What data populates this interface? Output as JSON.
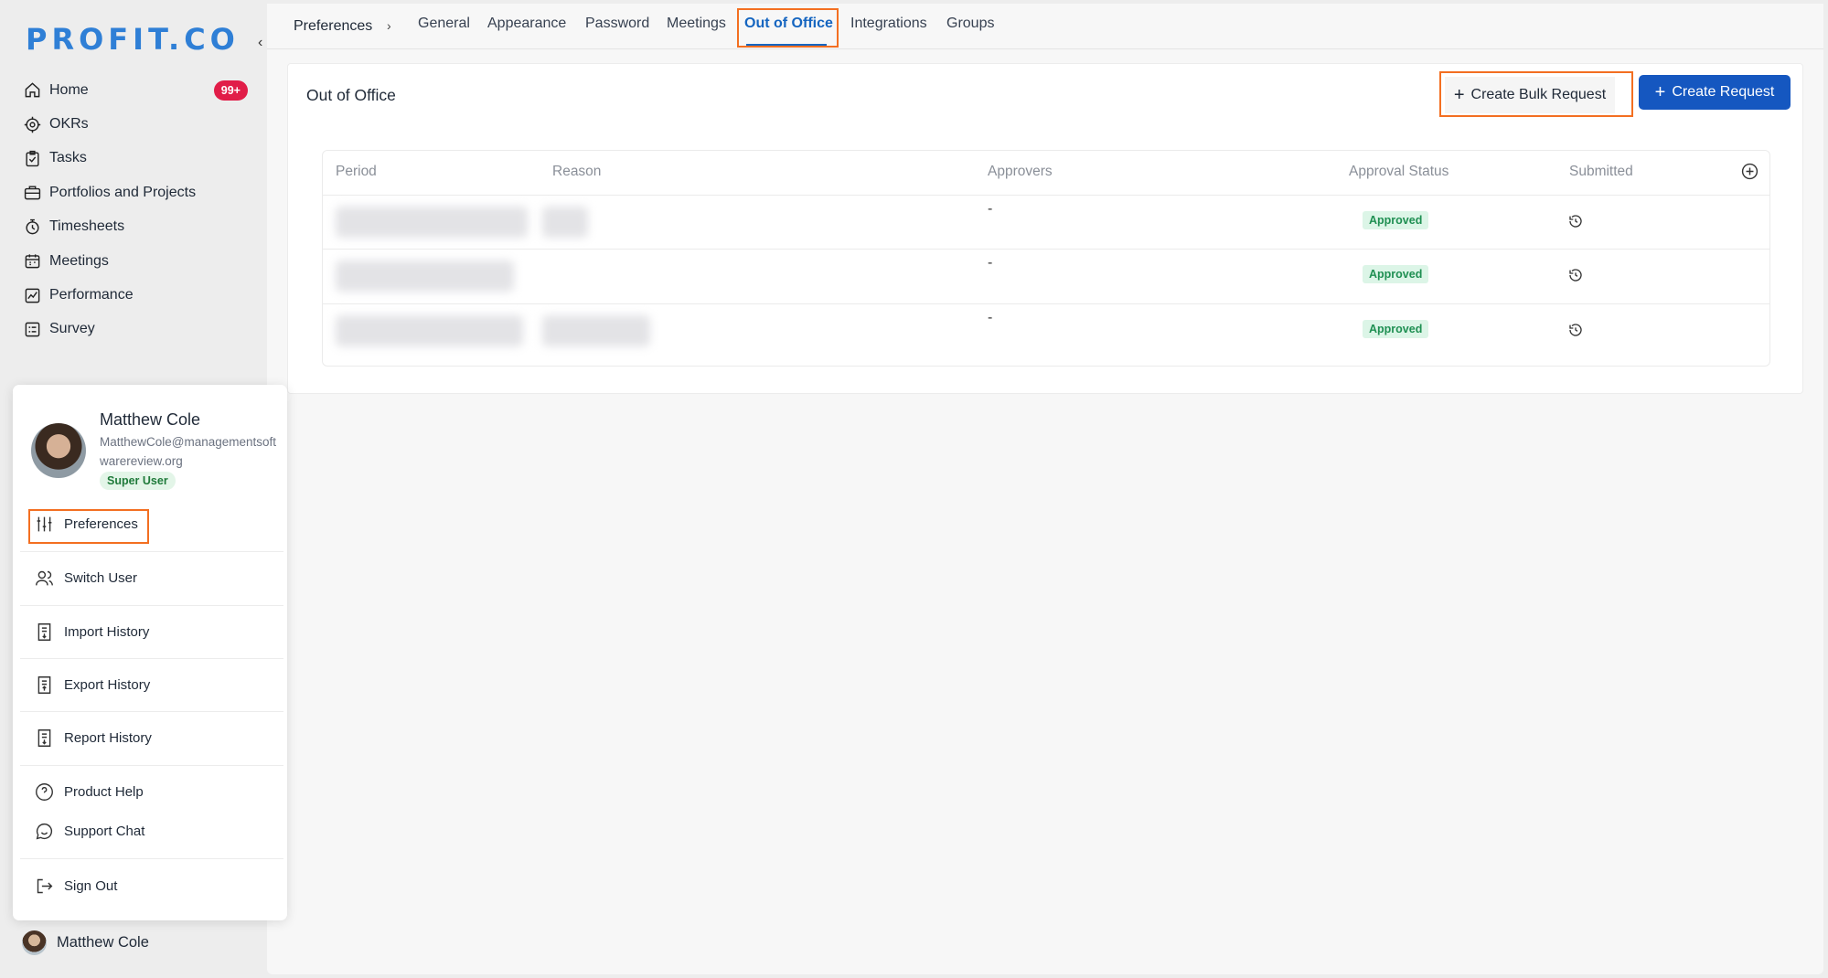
{
  "brand": {
    "logo_text": "PROFIT.CO",
    "accent": "#2f7fd6",
    "highlight": "#f36f21",
    "primary_button": "#1557c0"
  },
  "sidebar": {
    "items": [
      {
        "label": "Home",
        "icon": "home-icon",
        "badge": "99+"
      },
      {
        "label": "OKRs",
        "icon": "target-icon"
      },
      {
        "label": "Tasks",
        "icon": "clipboard-check-icon"
      },
      {
        "label": "Portfolios and Projects",
        "icon": "briefcase-icon"
      },
      {
        "label": "Timesheets",
        "icon": "stopwatch-icon"
      },
      {
        "label": "Meetings",
        "icon": "calendar-icon"
      },
      {
        "label": "Performance",
        "icon": "chart-line-icon"
      },
      {
        "label": "Survey",
        "icon": "survey-list-icon"
      }
    ],
    "footer_user": "Matthew Cole"
  },
  "tabbar": {
    "breadcrumb": "Preferences",
    "breadcrumb_separator": "›",
    "tabs": [
      "General",
      "Appearance",
      "Password",
      "Meetings",
      "Out of Office",
      "Integrations",
      "Groups"
    ],
    "active_tab": "Out of Office"
  },
  "card": {
    "title": "Out of Office",
    "bulk_button": "Create Bulk Request",
    "create_button": "Create Request"
  },
  "table": {
    "columns": [
      "Period",
      "Reason",
      "Approvers",
      "Approval Status",
      "Submitted"
    ],
    "rows": [
      {
        "approvers": "-",
        "status": "Approved"
      },
      {
        "approvers": "-",
        "status": "Approved"
      },
      {
        "approvers": "-",
        "status": "Approved"
      }
    ]
  },
  "user_menu": {
    "name": "Matthew Cole",
    "email": "MatthewCole@managementsoftwarereview.org",
    "role": "Super User",
    "items": [
      {
        "label": "Preferences",
        "icon": "sliders-icon"
      },
      {
        "label": "Switch User",
        "icon": "users-icon"
      },
      {
        "label": "Import History",
        "icon": "import-doc-icon"
      },
      {
        "label": "Export History",
        "icon": "export-doc-icon"
      },
      {
        "label": "Report History",
        "icon": "report-doc-icon"
      },
      {
        "label": "Product Help",
        "icon": "help-circle-icon"
      },
      {
        "label": "Support Chat",
        "icon": "chat-icon"
      },
      {
        "label": "Sign Out",
        "icon": "sign-out-icon"
      }
    ]
  }
}
